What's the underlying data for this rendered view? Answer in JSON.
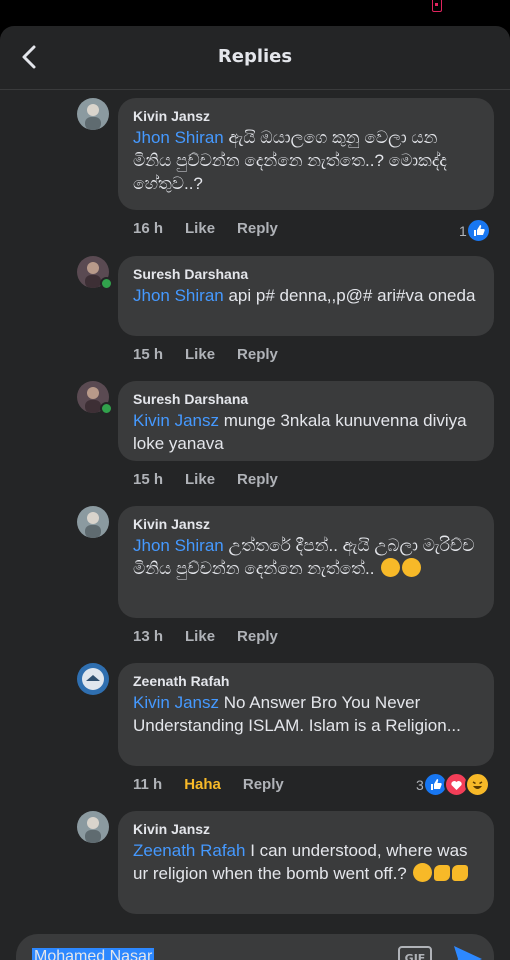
{
  "header": {
    "title": "Replies"
  },
  "comments": [
    {
      "author": "Kivin Jansz",
      "mention": "Jhon Shiran",
      "text": " ඇයි ඔයාලගෙ කුනු වෙලා යන මිනිය පුච්චන්න දෙන්නෙ නැත්තෙ..? මොකද්ද හේතුව..?",
      "time": "16 h",
      "like": "Like",
      "reply": "Reply",
      "reaction_count": "1"
    },
    {
      "author": "Suresh Darshana",
      "mention": "Jhon Shiran",
      "text": " api p# denna,,p@# ari#va oneda",
      "time": "15 h",
      "like": "Like",
      "reply": "Reply"
    },
    {
      "author": "Suresh Darshana",
      "mention": "Kivin Jansz",
      "text": " munge 3nkala kunuvenna diviya loke yanava",
      "time": "15 h",
      "like": "Like",
      "reply": "Reply"
    },
    {
      "author": "Kivin Jansz",
      "mention": "Jhon Shiran",
      "text": " උත්තරේ දීපන්.. ඇයි උබලා මැරිච්ච මිනිය පුච්චන්න දෙන්නෙ නැත්තේ..",
      "time": "13 h",
      "like": "Like",
      "reply": "Reply"
    },
    {
      "author": "Zeenath Rafah",
      "mention": "Kivin Jansz",
      "text": " No Answer Bro You Never Understanding ISLAM. Islam is a Religion...",
      "time": "11 h",
      "like": "Haha",
      "reply": "Reply",
      "reaction_count": "3"
    },
    {
      "author": "Kivin Jansz",
      "mention": "Zeenath Rafah",
      "text": " I can understood, where was ur religion when the bomb went off.?",
      "time": "",
      "like": "",
      "reply": ""
    }
  ],
  "composer": {
    "text": "Mohamed Nasar",
    "gif_label": "GIF"
  },
  "colors": {
    "background": "#242526",
    "bubble": "#3a3b3c",
    "mention": "#4599ff",
    "haha": "#f7b928"
  }
}
